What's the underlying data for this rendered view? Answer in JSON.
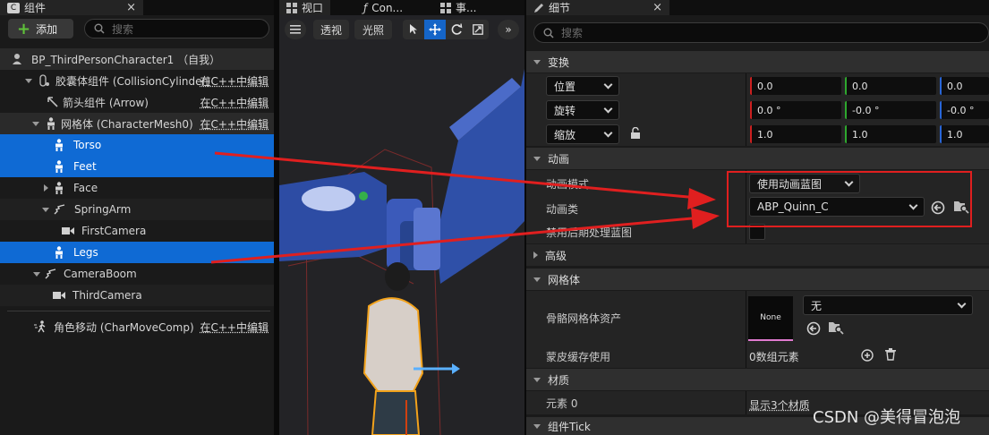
{
  "components_panel": {
    "tab_label": "组件",
    "add_button": "添加",
    "search_placeholder": "搜索",
    "root": "BP_ThirdPersonCharacter1 （自我）",
    "edit_in_cpp": "在C++中编辑",
    "items": [
      {
        "label": "胶囊体组件 (CollisionCylinder)"
      },
      {
        "label": "箭头组件 (Arrow)"
      },
      {
        "label": "网格体 (CharacterMesh0)"
      },
      {
        "label": "Torso"
      },
      {
        "label": "Feet"
      },
      {
        "label": "Face"
      },
      {
        "label": "SpringArm"
      },
      {
        "label": "FirstCamera"
      },
      {
        "label": "Legs"
      },
      {
        "label": "CameraBoom"
      },
      {
        "label": "ThirdCamera"
      },
      {
        "label": "角色移动 (CharMoveComp)"
      }
    ]
  },
  "viewport": {
    "tabs": [
      "视口",
      "Con...",
      "事..."
    ],
    "perspective_button": "透视",
    "lighting_button": "光照"
  },
  "details_panel": {
    "tab_label": "细节",
    "search_placeholder": "搜索",
    "sections": {
      "transform": "变换",
      "animation": "动画",
      "advanced": "高级",
      "mesh": "网格体",
      "materials": "材质",
      "component_tick": "组件Tick"
    },
    "transform": {
      "location": {
        "label": "位置",
        "x": "0.0",
        "y": "0.0",
        "z": "0.0"
      },
      "rotation": {
        "label": "旋转",
        "x": "0.0 °",
        "y": "-0.0 °",
        "z": "-0.0 °"
      },
      "scale": {
        "label": "缩放",
        "x": "1.0",
        "y": "1.0",
        "z": "1.0"
      }
    },
    "animation": {
      "mode_label": "动画模式",
      "mode_value": "使用动画蓝图",
      "class_label": "动画类",
      "class_value": "ABP_Quinn_C",
      "disable_label": "禁用后期处理蓝图"
    },
    "mesh": {
      "skeletal_label": "骨骼网格体资产",
      "thumbnail_text": "None",
      "asset_value": "无",
      "skin_cache_label": "蒙皮缓存使用",
      "skin_cache_value": "0数组元素"
    },
    "materials": {
      "element_label": "元素 0",
      "show_link": "显示3个材质"
    }
  },
  "watermark": "CSDN @美得冒泡泡",
  "colors": {
    "selection": "#0f6ad4",
    "annotation_red": "#e01f1f",
    "panel_bg": "#1a1a1a"
  }
}
